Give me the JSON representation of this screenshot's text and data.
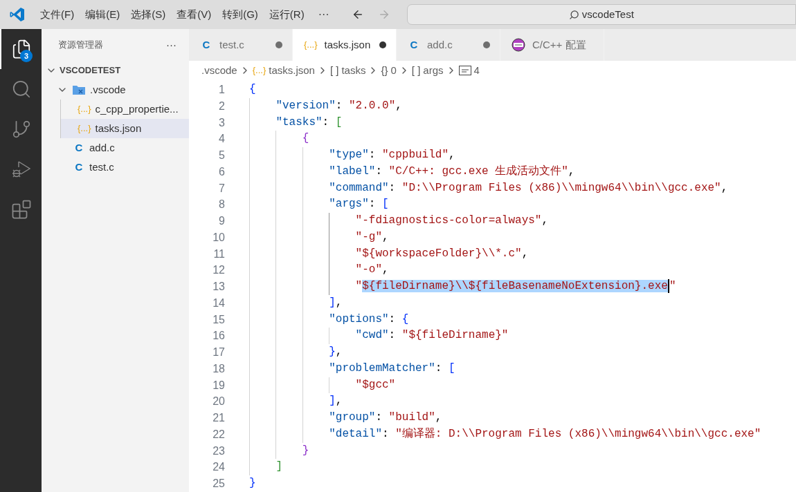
{
  "menu": {
    "items": [
      "文件(F)",
      "编辑(E)",
      "选择(S)",
      "查看(V)",
      "转到(G)",
      "运行(R)"
    ],
    "more": "···"
  },
  "search": {
    "value": "vscodeTest"
  },
  "activity_bar": [
    {
      "kind": "files",
      "selected": true,
      "badge": "3"
    },
    {
      "kind": "search",
      "selected": false
    },
    {
      "kind": "source-control",
      "selected": false
    },
    {
      "kind": "run-debug",
      "selected": false
    },
    {
      "kind": "extensions",
      "selected": false
    }
  ],
  "sidebar": {
    "title": "资源管理器",
    "more": "···",
    "workspace": {
      "label": "VSCODETEST",
      "expanded": true
    },
    "items": [
      {
        "kind": "folder",
        "label": ".vscode",
        "expanded": true,
        "selected": false,
        "children": [
          {
            "kind": "json",
            "icon": "{...}",
            "label": "c_cpp_propertie...",
            "selected": false
          },
          {
            "kind": "json",
            "icon": "{...}",
            "label": "tasks.json",
            "selected": true
          }
        ]
      },
      {
        "kind": "c",
        "icon": "C",
        "label": "add.c",
        "selected": false
      },
      {
        "kind": "c",
        "icon": "C",
        "label": "test.c",
        "selected": false
      }
    ]
  },
  "tabs": [
    {
      "kind": "c",
      "icon": "C",
      "label": "test.c",
      "selected": false,
      "modified": true
    },
    {
      "kind": "json",
      "icon": "{...}",
      "label": "tasks.json",
      "selected": true,
      "modified": true
    },
    {
      "kind": "c",
      "icon": "C",
      "label": "add.c",
      "selected": false,
      "modified": true
    },
    {
      "kind": "settings",
      "label": "C/C++ 配置",
      "selected": false,
      "modified": false
    }
  ],
  "breadcrumbs": [
    {
      "kind": "folder",
      "label": ".vscode"
    },
    {
      "kind": "json",
      "icon": "{...}",
      "label": "tasks.json"
    },
    {
      "kind": "symbol",
      "icon": "[ ]",
      "label": "tasks"
    },
    {
      "kind": "symbol",
      "icon": "{}",
      "label": "0"
    },
    {
      "kind": "symbol",
      "icon": "[ ]",
      "label": "args"
    },
    {
      "kind": "string",
      "label": "4"
    }
  ],
  "editor": {
    "lines": [
      {
        "number": "1",
        "tokens": [
          {
            "kind": "b1",
            "text": "{"
          }
        ]
      },
      {
        "number": "2",
        "guides": [
          {
            "active": false
          }
        ],
        "tokens": [
          {
            "kind": "key",
            "text": "\"version\""
          },
          {
            "kind": "punct",
            "text": ": "
          },
          {
            "kind": "string",
            "text": "\"2.0.0\""
          },
          {
            "kind": "punct",
            "text": ","
          }
        ]
      },
      {
        "number": "3",
        "guides": [
          {
            "active": false
          }
        ],
        "tokens": [
          {
            "kind": "key",
            "text": "\"tasks\""
          },
          {
            "kind": "punct",
            "text": ": "
          },
          {
            "kind": "b2",
            "text": "["
          }
        ]
      },
      {
        "number": "4",
        "guides": [
          {
            "active": false
          },
          {
            "active": false
          }
        ],
        "tokens": [
          {
            "kind": "b3",
            "text": "{"
          }
        ]
      },
      {
        "number": "5",
        "guides": [
          {
            "active": false
          },
          {
            "active": false
          },
          {
            "active": false
          }
        ],
        "tokens": [
          {
            "kind": "key",
            "text": "\"type\""
          },
          {
            "kind": "punct",
            "text": ": "
          },
          {
            "kind": "string",
            "text": "\"cppbuild\""
          },
          {
            "kind": "punct",
            "text": ","
          }
        ]
      },
      {
        "number": "6",
        "guides": [
          {
            "active": false
          },
          {
            "active": false
          },
          {
            "active": false
          }
        ],
        "tokens": [
          {
            "kind": "key",
            "text": "\"label\""
          },
          {
            "kind": "punct",
            "text": ": "
          },
          {
            "kind": "string",
            "text": "\"C/C++: gcc.exe 生成活动文件\""
          },
          {
            "kind": "punct",
            "text": ","
          }
        ]
      },
      {
        "number": "7",
        "guides": [
          {
            "active": false
          },
          {
            "active": false
          },
          {
            "active": false
          }
        ],
        "tokens": [
          {
            "kind": "key",
            "text": "\"command\""
          },
          {
            "kind": "punct",
            "text": ": "
          },
          {
            "kind": "string",
            "text": "\"D:\\\\Program Files (x86)\\\\mingw64\\\\bin\\\\gcc.exe\""
          },
          {
            "kind": "punct",
            "text": ","
          }
        ]
      },
      {
        "number": "8",
        "guides": [
          {
            "active": false
          },
          {
            "active": false
          },
          {
            "active": false
          }
        ],
        "tokens": [
          {
            "kind": "key",
            "text": "\"args\""
          },
          {
            "kind": "punct",
            "text": ": "
          },
          {
            "kind": "b1",
            "text": "["
          }
        ]
      },
      {
        "number": "9",
        "guides": [
          {
            "active": false
          },
          {
            "active": false
          },
          {
            "active": false
          },
          {
            "active": true
          }
        ],
        "tokens": [
          {
            "kind": "string",
            "text": "\"-fdiagnostics-color=always\""
          },
          {
            "kind": "punct",
            "text": ","
          }
        ]
      },
      {
        "number": "10",
        "guides": [
          {
            "active": false
          },
          {
            "active": false
          },
          {
            "active": false
          },
          {
            "active": true
          }
        ],
        "tokens": [
          {
            "kind": "string",
            "text": "\"-g\""
          },
          {
            "kind": "punct",
            "text": ","
          }
        ]
      },
      {
        "number": "11",
        "guides": [
          {
            "active": false
          },
          {
            "active": false
          },
          {
            "active": false
          },
          {
            "active": true
          }
        ],
        "tokens": [
          {
            "kind": "string",
            "text": "\"${workspaceFolder}\\\\*.c\""
          },
          {
            "kind": "punct",
            "text": ","
          }
        ]
      },
      {
        "number": "12",
        "guides": [
          {
            "active": false
          },
          {
            "active": false
          },
          {
            "active": false
          },
          {
            "active": true
          }
        ],
        "tokens": [
          {
            "kind": "string",
            "text": "\"-o\""
          },
          {
            "kind": "punct",
            "text": ","
          }
        ]
      },
      {
        "number": "13",
        "guides": [
          {
            "active": false
          },
          {
            "active": false
          },
          {
            "active": false
          },
          {
            "active": true
          }
        ],
        "tokens": [
          {
            "kind": "string",
            "text": "\""
          },
          {
            "kind": "string",
            "text": "${fileDirname}\\\\${fileBasenameNoExtension}.exe",
            "selected": true,
            "cursor": true
          },
          {
            "kind": "string",
            "text": "\""
          }
        ]
      },
      {
        "number": "14",
        "guides": [
          {
            "active": false
          },
          {
            "active": false
          },
          {
            "active": false
          }
        ],
        "tokens": [
          {
            "kind": "b1",
            "text": "]"
          },
          {
            "kind": "punct",
            "text": ","
          }
        ]
      },
      {
        "number": "15",
        "guides": [
          {
            "active": false
          },
          {
            "active": false
          },
          {
            "active": false
          }
        ],
        "tokens": [
          {
            "kind": "key",
            "text": "\"options\""
          },
          {
            "kind": "punct",
            "text": ": "
          },
          {
            "kind": "b1",
            "text": "{"
          }
        ]
      },
      {
        "number": "16",
        "guides": [
          {
            "active": false
          },
          {
            "active": false
          },
          {
            "active": false
          },
          {
            "active": false
          }
        ],
        "tokens": [
          {
            "kind": "key",
            "text": "\"cwd\""
          },
          {
            "kind": "punct",
            "text": ": "
          },
          {
            "kind": "string",
            "text": "\"${fileDirname}\""
          }
        ]
      },
      {
        "number": "17",
        "guides": [
          {
            "active": false
          },
          {
            "active": false
          },
          {
            "active": false
          }
        ],
        "tokens": [
          {
            "kind": "b1",
            "text": "}"
          },
          {
            "kind": "punct",
            "text": ","
          }
        ]
      },
      {
        "number": "18",
        "guides": [
          {
            "active": false
          },
          {
            "active": false
          },
          {
            "active": false
          }
        ],
        "tokens": [
          {
            "kind": "key",
            "text": "\"problemMatcher\""
          },
          {
            "kind": "punct",
            "text": ": "
          },
          {
            "kind": "b1",
            "text": "["
          }
        ]
      },
      {
        "number": "19",
        "guides": [
          {
            "active": false
          },
          {
            "active": false
          },
          {
            "active": false
          },
          {
            "active": false
          }
        ],
        "tokens": [
          {
            "kind": "string",
            "text": "\"$gcc\""
          }
        ]
      },
      {
        "number": "20",
        "guides": [
          {
            "active": false
          },
          {
            "active": false
          },
          {
            "active": false
          }
        ],
        "tokens": [
          {
            "kind": "b1",
            "text": "]"
          },
          {
            "kind": "punct",
            "text": ","
          }
        ]
      },
      {
        "number": "21",
        "guides": [
          {
            "active": false
          },
          {
            "active": false
          },
          {
            "active": false
          }
        ],
        "tokens": [
          {
            "kind": "key",
            "text": "\"group\""
          },
          {
            "kind": "punct",
            "text": ": "
          },
          {
            "kind": "string",
            "text": "\"build\""
          },
          {
            "kind": "punct",
            "text": ","
          }
        ]
      },
      {
        "number": "22",
        "guides": [
          {
            "active": false
          },
          {
            "active": false
          },
          {
            "active": false
          }
        ],
        "tokens": [
          {
            "kind": "key",
            "text": "\"detail\""
          },
          {
            "kind": "punct",
            "text": ": "
          },
          {
            "kind": "string",
            "text": "\"编译器: D:\\\\Program Files (x86)\\\\mingw64\\\\bin\\\\gcc.exe\""
          }
        ]
      },
      {
        "number": "23",
        "guides": [
          {
            "active": false
          },
          {
            "active": false
          }
        ],
        "tokens": [
          {
            "kind": "b3",
            "text": "}"
          }
        ]
      },
      {
        "number": "24",
        "guides": [
          {
            "active": false
          }
        ],
        "tokens": [
          {
            "kind": "b2",
            "text": "]"
          }
        ]
      },
      {
        "number": "25",
        "tokens": [
          {
            "kind": "b1",
            "text": "}"
          }
        ]
      }
    ]
  }
}
